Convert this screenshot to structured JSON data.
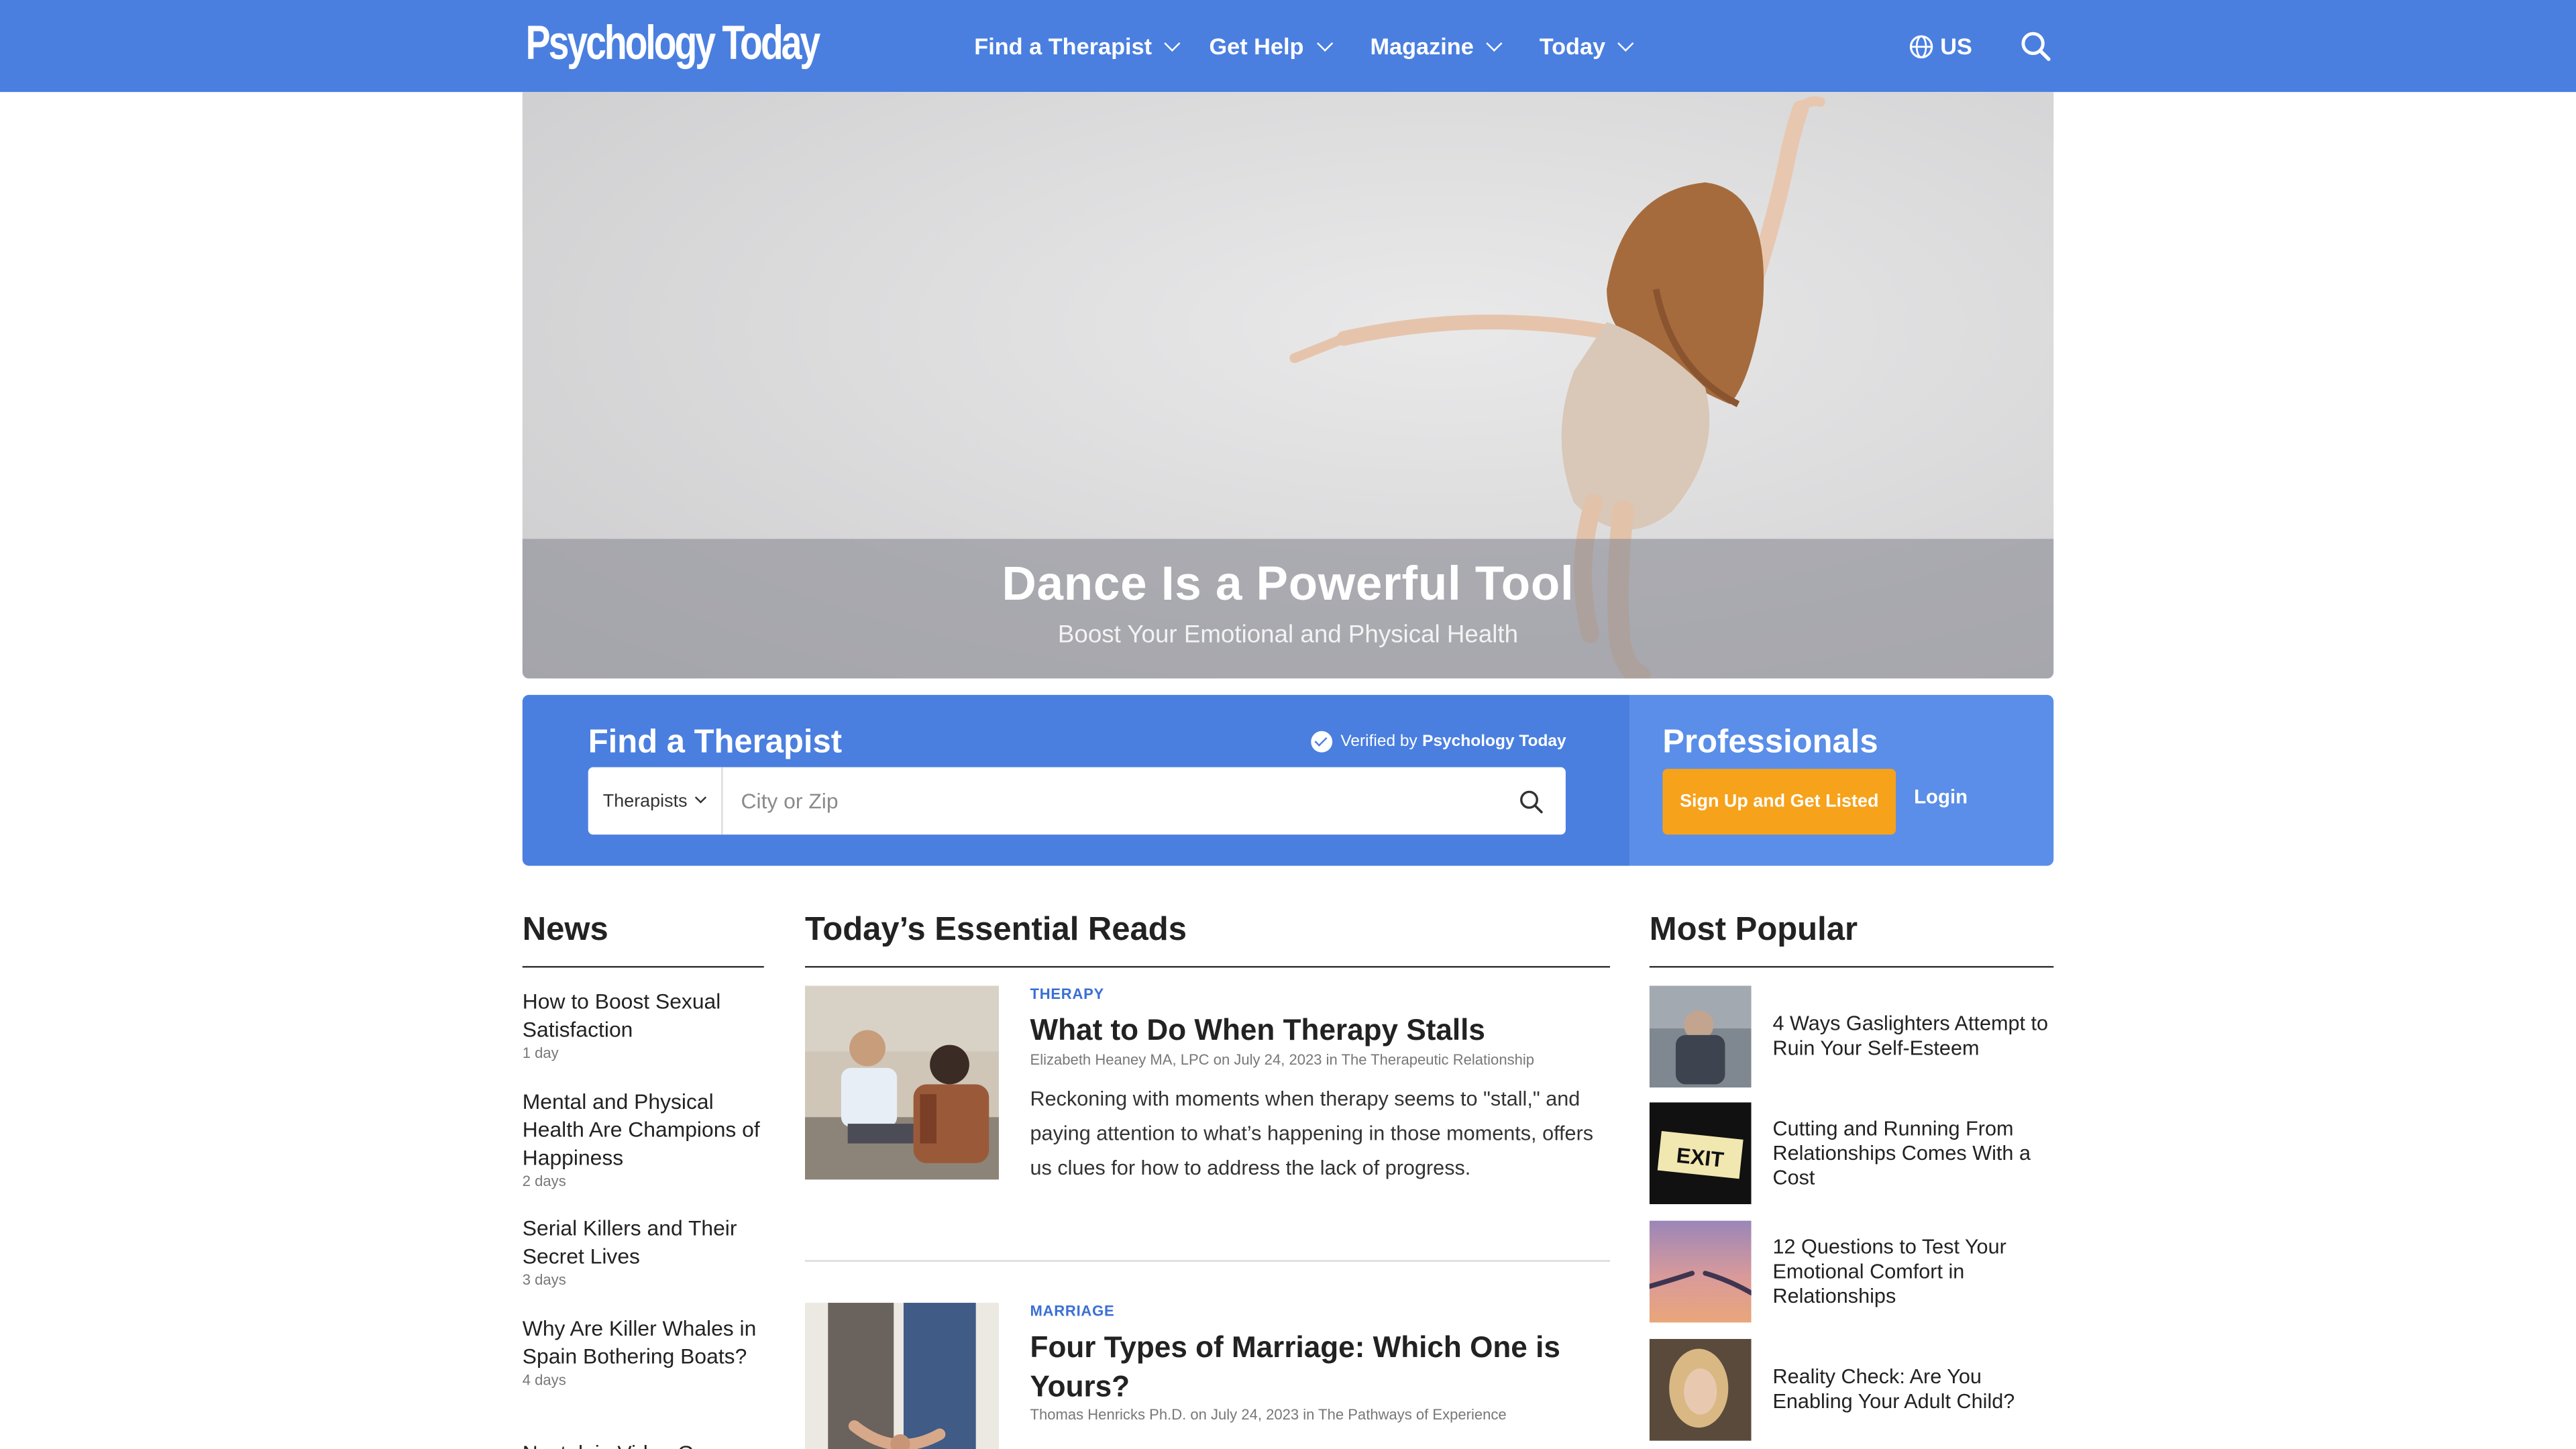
{
  "header": {
    "logo": "Psychology Today",
    "nav": [
      {
        "label": "Find a Therapist"
      },
      {
        "label": "Get Help"
      },
      {
        "label": "Magazine"
      },
      {
        "label": "Today"
      }
    ],
    "region": "US",
    "colors": {
      "brand_blue": "#4a7fe0",
      "accent_orange": "#f7a21b"
    }
  },
  "hero": {
    "title": "Dance Is a Powerful Tool",
    "subtitle": "Boost Your Emotional and Physical Health"
  },
  "finder": {
    "title": "Find a Therapist",
    "verified_prefix": "Verified by",
    "verified_brand": "Psychology Today",
    "type_selected": "Therapists",
    "placeholder": "City or Zip"
  },
  "professionals": {
    "title": "Professionals",
    "signup_label": "Sign Up and Get Listed",
    "login_label": "Login"
  },
  "news": {
    "title": "News",
    "items": [
      {
        "title": "How to Boost Sexual Satisfaction",
        "age": "1 day"
      },
      {
        "title": "Mental and Physical Health Are Champions of Happiness",
        "age": "2 days"
      },
      {
        "title": "Serial Killers and Their Secret Lives",
        "age": "3 days"
      },
      {
        "title": "Why Are Killer Whales in Spain Bothering Boats?",
        "age": "4 days"
      },
      {
        "title": "Nostalgia Video G"
      }
    ]
  },
  "essential": {
    "title": "Today’s Essential Reads",
    "articles": [
      {
        "kicker": "THERAPY",
        "title": "What to Do When Therapy Stalls",
        "byline": "Elizabeth Heaney MA, LPC on July 24, 2023 in The Therapeutic Relationship",
        "body": "Reckoning with moments when therapy seems to \"stall,\" and paying attention to what’s happening in those moments, offers us clues for how to address the lack of progress."
      },
      {
        "kicker": "MARRIAGE",
        "title": "Four Types of Marriage: Which One is Yours?",
        "byline": "Thomas Henricks Ph.D. on July 24, 2023 in The Pathways of Experience"
      }
    ]
  },
  "popular": {
    "title": "Most Popular",
    "items": [
      {
        "title": "4 Ways Gaslighters Attempt to Ruin Your Self-Esteem"
      },
      {
        "title": "Cutting and Running From Relationships Comes With a Cost"
      },
      {
        "title": "12 Questions to Test Your Emotional Comfort in Relationships"
      },
      {
        "title": "Reality Check: Are You Enabling Your Adult Child?"
      }
    ],
    "exit_sign": "EXIT"
  }
}
